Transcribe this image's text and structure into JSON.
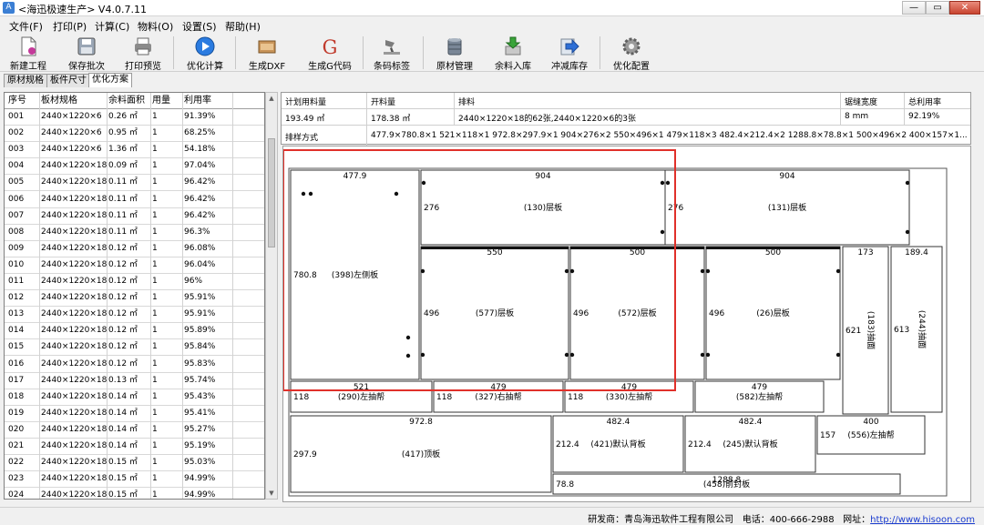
{
  "window": {
    "title": "<海迅极速生产> V4.0.7.11",
    "controls": [
      "—",
      "▭",
      "✕"
    ]
  },
  "menu": [
    {
      "label": "文件(F)"
    },
    {
      "label": "打印(P)"
    },
    {
      "label": "计算(C)"
    },
    {
      "label": "物料(O)"
    },
    {
      "label": "设置(S)"
    },
    {
      "label": "帮助(H)"
    }
  ],
  "toolbar": [
    {
      "label": "新建工程",
      "icon": "new-document-icon"
    },
    {
      "label": "保存批次",
      "icon": "save-disk-icon"
    },
    {
      "label": "打印预览",
      "icon": "printer-icon"
    },
    {
      "label": "优化计算",
      "icon": "play-icon"
    },
    {
      "label": "生成DXF",
      "icon": "dxf-file-icon"
    },
    {
      "label": "生成G代码",
      "icon": "g-code-icon"
    },
    {
      "label": "条码标签",
      "icon": "barcode-scanner-icon"
    },
    {
      "label": "原材管理",
      "icon": "database-icon"
    },
    {
      "label": "余料入库",
      "icon": "inbound-arrow-icon"
    },
    {
      "label": "冲减库存",
      "icon": "arrow-right-icon"
    },
    {
      "label": "优化配置",
      "icon": "gear-icon"
    }
  ],
  "tabs": [
    {
      "label": "原材规格"
    },
    {
      "label": "板件尺寸"
    },
    {
      "label": "优化方案",
      "active": true
    }
  ],
  "left_table": {
    "headers": [
      "序号",
      "板材规格",
      "余料面积",
      "用量",
      "利用率"
    ],
    "rows": [
      [
        "001",
        "2440×1220×6",
        "0.26 ㎡",
        "1",
        "91.39%"
      ],
      [
        "002",
        "2440×1220×6",
        "0.95 ㎡",
        "1",
        "68.25%"
      ],
      [
        "003",
        "2440×1220×6",
        "1.36 ㎡",
        "1",
        "54.18%"
      ],
      [
        "004",
        "2440×1220×18",
        "0.09 ㎡",
        "1",
        "97.04%"
      ],
      [
        "005",
        "2440×1220×18",
        "0.11 ㎡",
        "1",
        "96.42%"
      ],
      [
        "006",
        "2440×1220×18",
        "0.11 ㎡",
        "1",
        "96.42%"
      ],
      [
        "007",
        "2440×1220×18",
        "0.11 ㎡",
        "1",
        "96.42%"
      ],
      [
        "008",
        "2440×1220×18",
        "0.11 ㎡",
        "1",
        "96.3%"
      ],
      [
        "009",
        "2440×1220×18",
        "0.12 ㎡",
        "1",
        "96.08%"
      ],
      [
        "010",
        "2440×1220×18",
        "0.12 ㎡",
        "1",
        "96.04%"
      ],
      [
        "011",
        "2440×1220×18",
        "0.12 ㎡",
        "1",
        "96%"
      ],
      [
        "012",
        "2440×1220×18",
        "0.12 ㎡",
        "1",
        "95.91%"
      ],
      [
        "013",
        "2440×1220×18",
        "0.12 ㎡",
        "1",
        "95.91%"
      ],
      [
        "014",
        "2440×1220×18",
        "0.12 ㎡",
        "1",
        "95.89%"
      ],
      [
        "015",
        "2440×1220×18",
        "0.12 ㎡",
        "1",
        "95.84%"
      ],
      [
        "016",
        "2440×1220×18",
        "0.12 ㎡",
        "1",
        "95.83%"
      ],
      [
        "017",
        "2440×1220×18",
        "0.13 ㎡",
        "1",
        "95.74%"
      ],
      [
        "018",
        "2440×1220×18",
        "0.14 ㎡",
        "1",
        "95.43%"
      ],
      [
        "019",
        "2440×1220×18",
        "0.14 ㎡",
        "1",
        "95.41%"
      ],
      [
        "020",
        "2440×1220×18",
        "0.14 ㎡",
        "1",
        "95.27%"
      ],
      [
        "021",
        "2440×1220×18",
        "0.14 ㎡",
        "1",
        "95.19%"
      ],
      [
        "022",
        "2440×1220×18",
        "0.15 ㎡",
        "1",
        "95.03%"
      ],
      [
        "023",
        "2440×1220×18",
        "0.15 ㎡",
        "1",
        "94.99%"
      ],
      [
        "024",
        "2440×1220×18",
        "0.15 ㎡",
        "1",
        "94.99%"
      ]
    ]
  },
  "summary": {
    "headers": [
      "计划用料量",
      "开料量",
      "排料",
      "锯缝宽度",
      "总利用率"
    ],
    "values": [
      "193.49 ㎡",
      "178.38 ㎡",
      "2440×1220×18的62张,2440×1220×6的3张",
      "8 mm",
      "92.19%"
    ],
    "layout_label": "排样方式",
    "layout_value": "477.9×780.8×1 521×118×1 972.8×297.9×1 904×276×2 550×496×1 479×118×3 482.4×212.4×2 1288.8×78.8×1 500×496×2 400×157×1..."
  },
  "layout_panels": [
    {
      "label": "(398)左侧板",
      "w": "477.9",
      "h": "780.8"
    },
    {
      "label": "(130)层板",
      "w": "904",
      "h": "276"
    },
    {
      "label": "(131)层板",
      "w": "904",
      "h": "276"
    },
    {
      "label": "(577)层板",
      "w": "550",
      "h": "496"
    },
    {
      "label": "(572)层板",
      "w": "500",
      "h": "496"
    },
    {
      "label": "(26)层板",
      "w": "500",
      "h": "496"
    },
    {
      "label": "(183)抽面",
      "w": "173",
      "h": "621"
    },
    {
      "label": "(244)抽面",
      "w": "189.4",
      "h": "613"
    },
    {
      "label": "(290)左抽帮",
      "w": "521",
      "h": "118"
    },
    {
      "label": "(327)右抽帮",
      "w": "479",
      "h": "118"
    },
    {
      "label": "(330)左抽帮",
      "w": "479",
      "h": "118"
    },
    {
      "label": "(582)左抽帮",
      "w": "479",
      "h": ""
    },
    {
      "label": "(417)顶板",
      "w": "972.8",
      "h": "297.9"
    },
    {
      "label": "(421)默认背板",
      "w": "482.4",
      "h": "212.4"
    },
    {
      "label": "(245)默认背板",
      "w": "482.4",
      "h": "212.4"
    },
    {
      "label": "(556)左抽帮",
      "w": "400",
      "h": "157"
    },
    {
      "label": "(458)前封板",
      "w": "1288.8",
      "h": "78.8"
    }
  ],
  "status": {
    "developer": "研发商：青岛海迅软件工程有限公司",
    "phone": "电话：400-666-2988",
    "website_label": "网址：",
    "website": "http://www.hisoon.com"
  },
  "colors": {
    "annotation_red": "#e0302a",
    "link_blue": "#1a3ccf",
    "selection_blue": "#2e6fd6"
  }
}
